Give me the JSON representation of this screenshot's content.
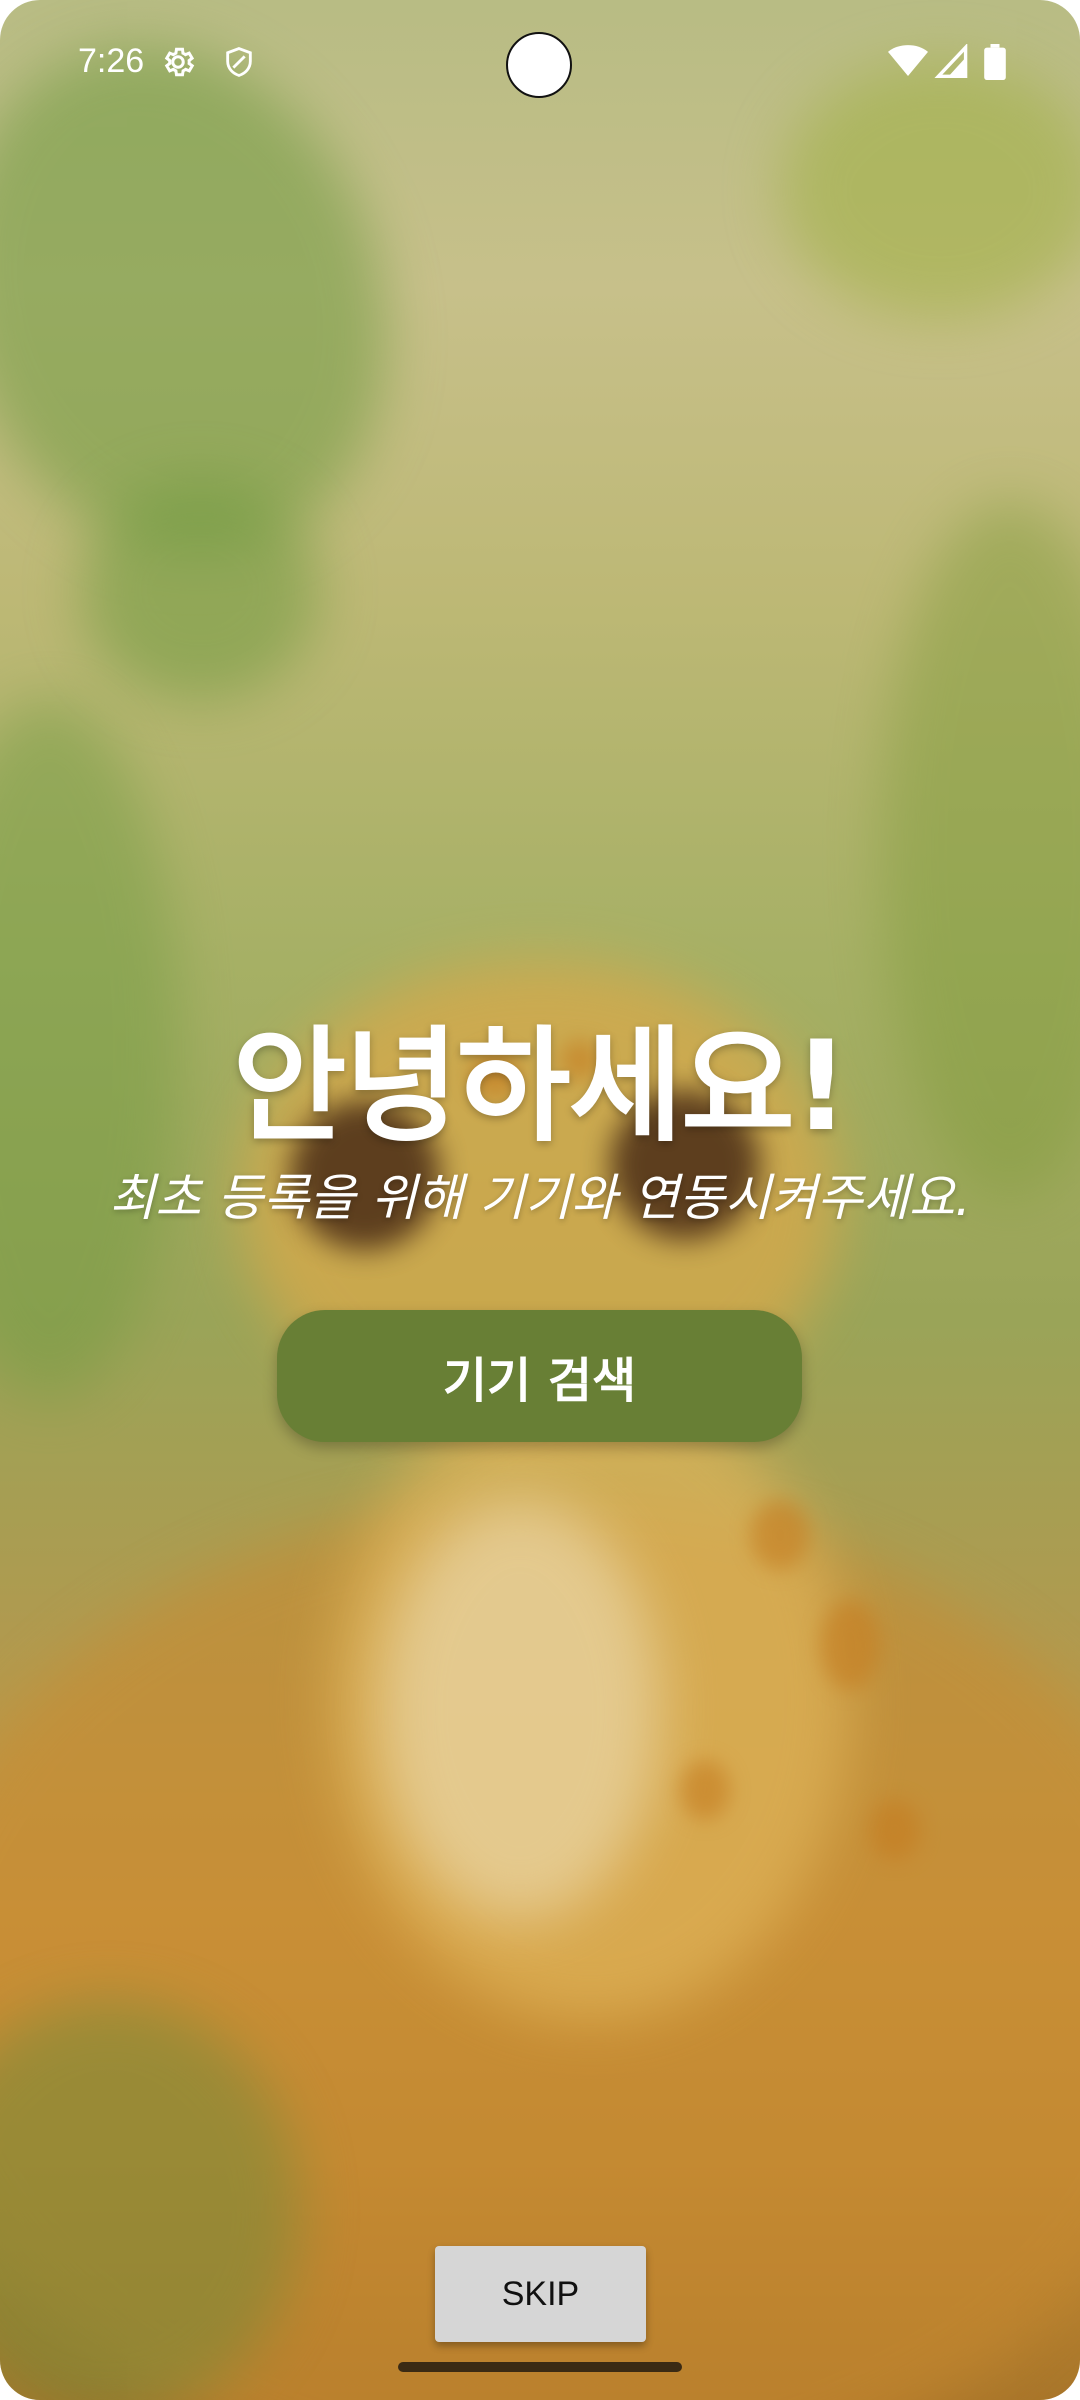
{
  "status_bar": {
    "time": "7:26",
    "icons": [
      "gear-icon",
      "shield-icon",
      "wifi-icon",
      "signal-icon",
      "battery-icon"
    ]
  },
  "main": {
    "greeting": "안녕하세요!",
    "subtitle": "최초 등록을 위해 기기와 연동시켜주세요.",
    "search_button_label": "기기 검색",
    "skip_button_label": "SKIP"
  },
  "colors": {
    "primary_button": "#687f35",
    "skip_button": "#d6d6d6",
    "text": "#ffffff"
  }
}
